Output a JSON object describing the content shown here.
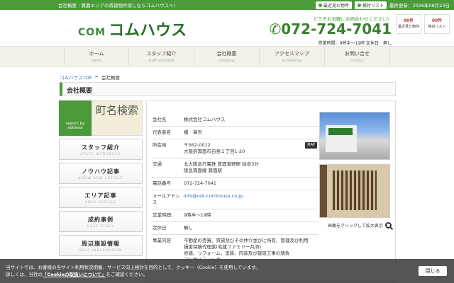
{
  "topbar": {
    "text": "会社概要｜箕面エリアの賃貸物件探しならコムハウスへ！",
    "recent_btn": "最近見た物件",
    "list_btn": "検討リスト",
    "updated": "最終更新：2026年08月23日"
  },
  "header": {
    "logo_com": "COM",
    "logo_name": "コムハウス",
    "catch": "どうぞお気軽にお問合わせください！",
    "tel": "072-724-7041",
    "hours": "営業時間：9時半〜19時 定休日：無し",
    "counters": [
      {
        "num": "00",
        "unit": "件",
        "label": "最近見た物件"
      },
      {
        "num": "00",
        "unit": "件",
        "label": "検討リスト"
      }
    ]
  },
  "gnav": [
    {
      "jp": "ホーム",
      "en": "home"
    },
    {
      "jp": "スタッフ紹介",
      "en": "staff introduce"
    },
    {
      "jp": "会社概要",
      "en": "company"
    },
    {
      "jp": "アクセスマップ",
      "en": "accessmap"
    },
    {
      "jp": "お問い合せ",
      "en": "contact"
    }
  ],
  "breadcrumb": {
    "home": "コムハウスTOP",
    "sep": ">",
    "current": "会社概要"
  },
  "page_title": "会社概要",
  "sidebar": {
    "search_en": "search by address",
    "search_jp": "町名検索",
    "items": [
      {
        "jp": "スタッフ紹介",
        "en": "STAFF INTRODUCE"
      },
      {
        "jp": "ノウハウ記事",
        "en": "KNOW-HOW ARTICLE"
      },
      {
        "jp": "エリア記事",
        "en": "AREA ARTICLE"
      },
      {
        "jp": "成約事例",
        "en": "CASE STUDY"
      },
      {
        "jp": "周辺施設情報",
        "en": "SPOT INFORMATION"
      }
    ]
  },
  "info": {
    "rows": [
      {
        "k": "会社名",
        "v": "株式会社コムハウス"
      },
      {
        "k": "代表者名",
        "v": "橋　章吾"
      },
      {
        "k": "所在地",
        "v": "〒562-0012\n大阪府箕面市白島１丁目1-20",
        "map": "MAP"
      },
      {
        "k": "交通",
        "v": "北大阪急行電鉄 箕面萱野駅 徒歩3分\n阪急箕面線 箕面駅"
      },
      {
        "k": "電話番号",
        "v": "072-724-7041"
      },
      {
        "k": "メールアドレス",
        "v": "info@osk-comhouse.co.jp",
        "link": true
      },
      {
        "k": "営業時間",
        "v": "9時半〜19時"
      },
      {
        "k": "定休日",
        "v": "無し"
      },
      {
        "k": "事業内容",
        "v": "不動産の売買、賃貸及びその仲介並びに所有、管理及び利用\n損害保険代理業(宅建ファミリー共済)\n修繕、リフォーム、塗装、内装及び建設工事の請負\nコンサルティング"
      }
    ]
  },
  "photo_caption": "画像をクリックして拡大表示",
  "cookie": {
    "line1": "当サイトでは、お客様の当サイト利用状況把握、サービス向上検討を目的として、クッキー（Cookie）を使用しています。",
    "line2_pre": "詳しくは、当社の",
    "line2_link": "「Cookieの取扱いについて」",
    "line2_post": "をご確認ください。",
    "close": "閉じる"
  }
}
